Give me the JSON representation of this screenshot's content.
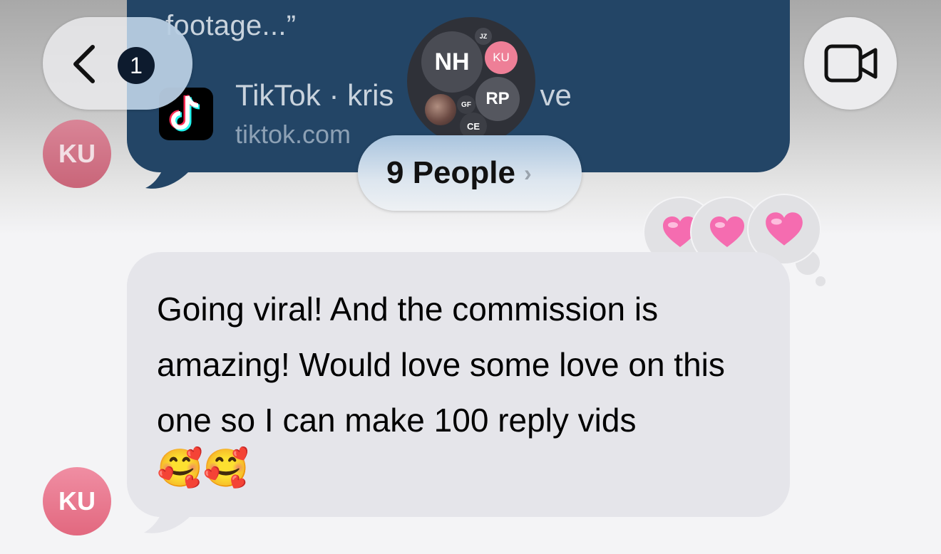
{
  "thread": {
    "link_preview": {
      "quote": "footage...”",
      "title": "TikTok · kris",
      "title_end": "ve",
      "url": "tiktok.com",
      "sender_initials": "KU"
    },
    "message": {
      "text": "Going viral! And the commission is amazing! Would love some love on this one so I can make 100 reply vids",
      "emojis": "🥰🥰",
      "sender_initials": "KU",
      "reactions": [
        "🩷",
        "🩷",
        "🩷"
      ]
    }
  },
  "header": {
    "back_badge": "1",
    "group": {
      "members": [
        "JZ",
        "NH",
        "KU",
        "RP",
        "GF",
        "CE"
      ],
      "people_label": "9 People",
      "chevron": "›"
    },
    "video_icon": "video-camera-icon",
    "back_icon": "chevron-left-icon"
  },
  "colors": {
    "link_bubble": "#234566",
    "incoming_bubble": "#e5e5ea",
    "avatar_pink": "#e97a90"
  }
}
